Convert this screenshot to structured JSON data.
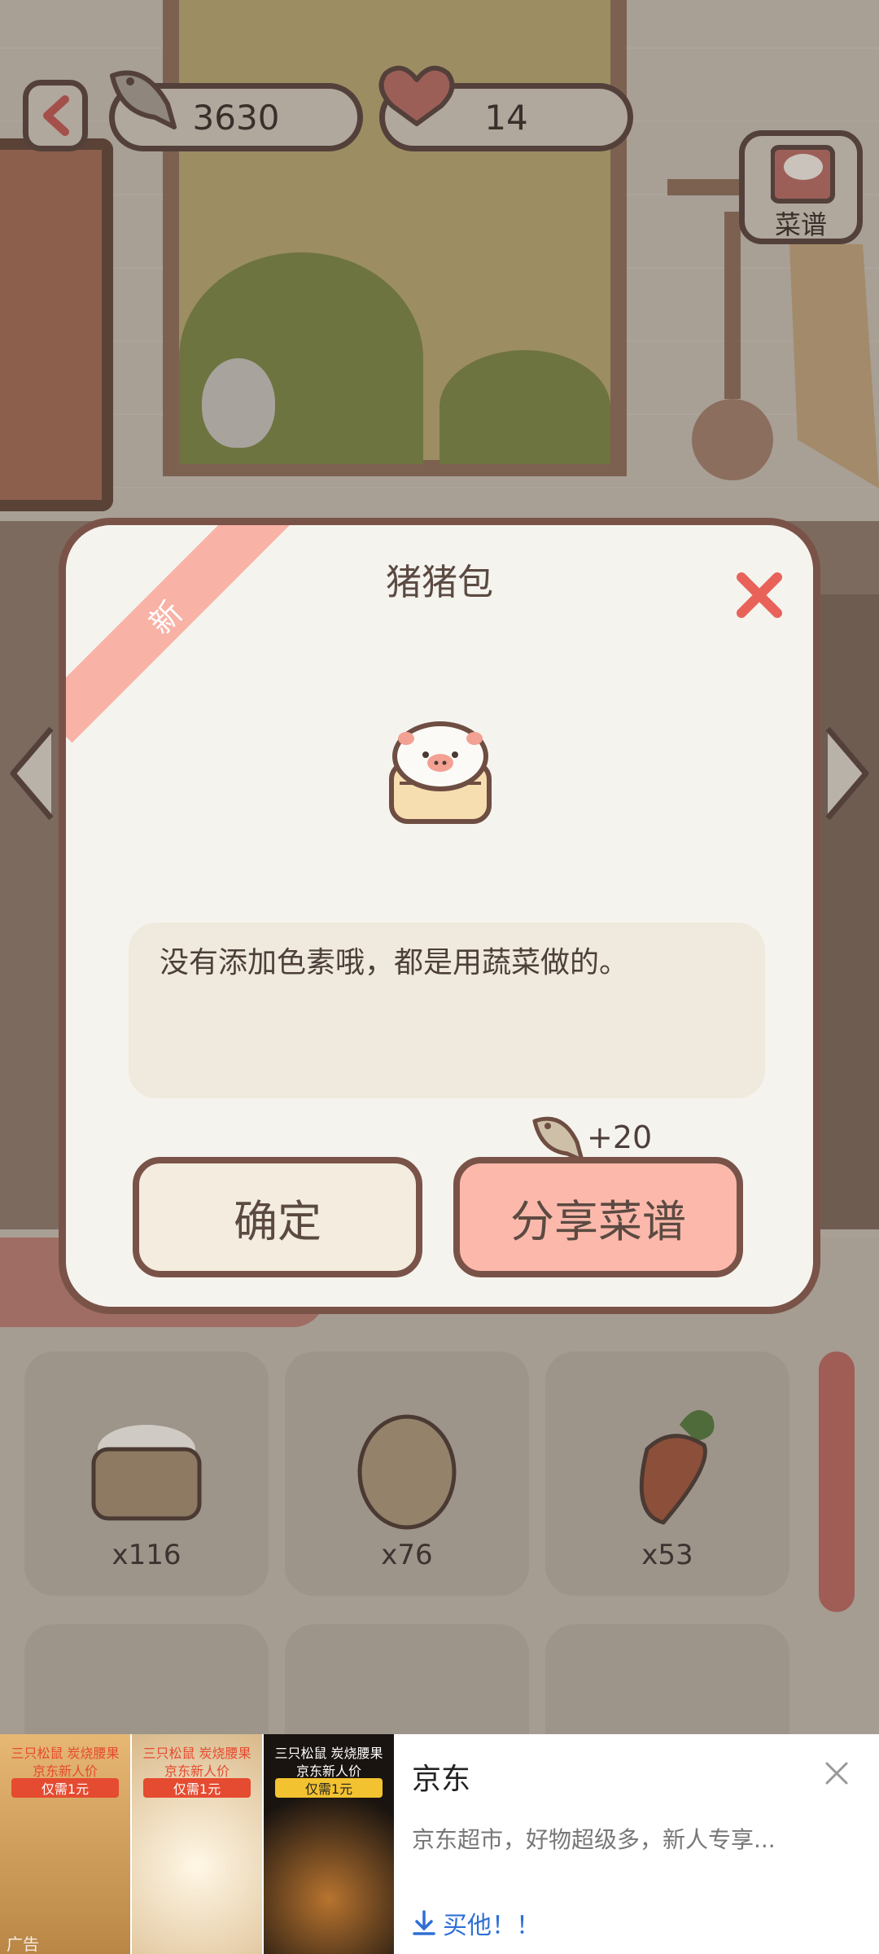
{
  "hud": {
    "back_icon": "chevron-left-icon",
    "fish_count": "3630",
    "heart_count": "14",
    "menu_label": "菜谱"
  },
  "dialog": {
    "badge": "新",
    "title": "猪猪包",
    "description": "没有添加色素哦，都是用蔬菜做的。",
    "reward": "+20",
    "confirm_label": "确定",
    "share_label": "分享菜谱"
  },
  "inventory": [
    {
      "item": "flour-sack",
      "count": "x116"
    },
    {
      "item": "egg",
      "count": "x76"
    },
    {
      "item": "carrot",
      "count": "x53"
    }
  ],
  "ad": {
    "images": [
      {
        "line1": "三只松鼠 炭烧腰果",
        "line2": "京东新人价",
        "line3": "仅需1元"
      },
      {
        "line1": "三只松鼠 炭烧腰果",
        "line2": "京东新人价",
        "line3": "仅需1元"
      },
      {
        "line1": "三只松鼠 炭烧腰果",
        "line2": "京东新人价",
        "line3": "仅需1元"
      }
    ],
    "tag": "广告",
    "brand": "京东",
    "description": "京东超市，好物超级多，新人专享...",
    "cta": "买他！！"
  },
  "colors": {
    "accent": "#f9b3a6",
    "close": "#e8625a",
    "border": "#7a5348"
  }
}
